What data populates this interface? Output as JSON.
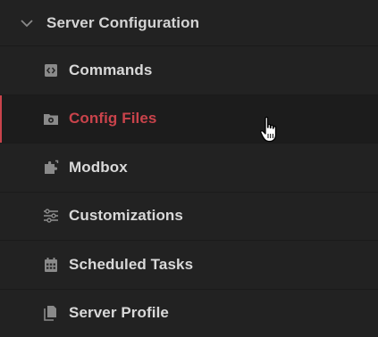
{
  "section": {
    "title": "Server Configuration",
    "icon": "chevron-down-icon"
  },
  "items": [
    {
      "label": "Commands",
      "icon": "code-brackets-icon"
    },
    {
      "label": "Config Files",
      "icon": "folder-gear-icon",
      "active": true
    },
    {
      "label": "Modbox",
      "icon": "puzzle-icon"
    },
    {
      "label": "Customizations",
      "icon": "sliders-icon"
    },
    {
      "label": "Scheduled Tasks",
      "icon": "calendar-icon"
    },
    {
      "label": "Server Profile",
      "icon": "document-copy-icon"
    }
  ],
  "colors": {
    "background": "#222222",
    "text": "#d9d9d9",
    "accent": "#c9434b",
    "icon": "#8a8a8a"
  }
}
